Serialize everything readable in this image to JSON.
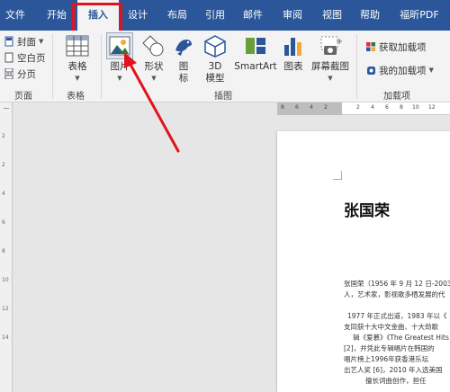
{
  "tabs": [
    "文件",
    "开始",
    "插入",
    "设计",
    "布局",
    "引用",
    "邮件",
    "审阅",
    "视图",
    "帮助",
    "福昕PDF"
  ],
  "active_tab": "插入",
  "ribbon": {
    "pages_group": {
      "items": [
        "封面",
        "空白页",
        "分页"
      ],
      "label": "页面"
    },
    "tables_group": {
      "table_label": "表格",
      "label": "表格"
    },
    "illustrations_group": {
      "picture": "图片",
      "shapes": "形状",
      "icons": "图\n标",
      "model_3d": "3D\n模型",
      "smartart": "SmartArt",
      "chart": "图表",
      "screenshot": "屏幕截图",
      "label": "插图"
    },
    "addins_group": {
      "get_addins": "获取加载项",
      "my_addins": "我的加载项",
      "label": "加载项"
    }
  },
  "ruler": {
    "h_numbers": [
      "8",
      "6",
      "4",
      "2",
      "2",
      "4",
      "6",
      "8",
      "10",
      "12"
    ],
    "v_numbers": [
      "2",
      "2",
      "4",
      "6",
      "8",
      "10",
      "12",
      "14"
    ]
  },
  "document": {
    "title": "张国荣",
    "lines": [
      "张国荣（1956 年 9 月 12 日-2003",
      "人，艺术家，影视歌多栖发展的代",
      "1977 年正式出道，1983 年以《",
      "支同获十大中文金曲、十大劲歌",
      "辑《爱慕》《The Greatest Hits",
      "[2]，并凭此专辑唱片在韩国的",
      "唱片榜上1996年获香港乐坛",
      "出艺人奖 [6]，2010 年入选美国",
      "擅长词曲创作，担任"
    ]
  },
  "colors": {
    "tab_bar": "#2b579a",
    "ribbon_bg": "#f3f3f3",
    "highlight": "#e0141e"
  }
}
